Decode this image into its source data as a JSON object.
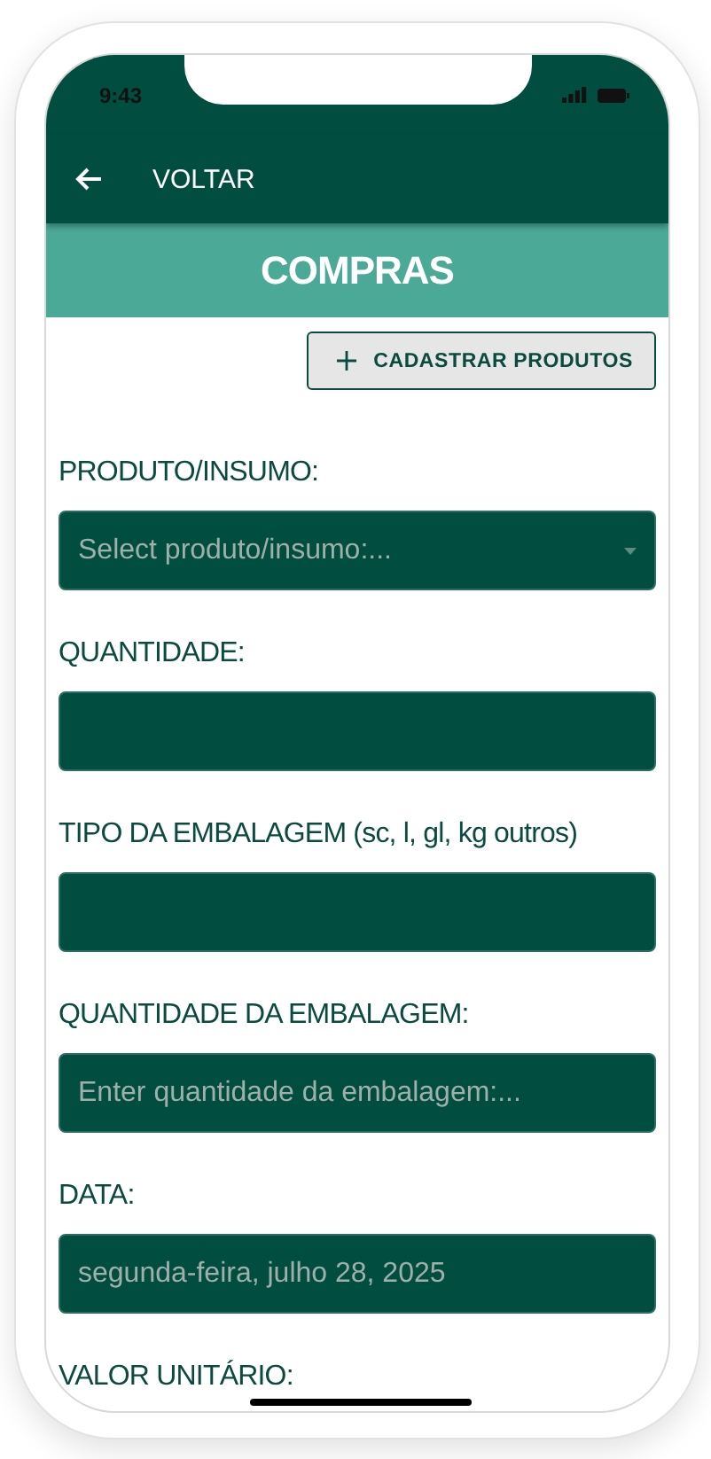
{
  "status_bar": {
    "time": "9:43"
  },
  "nav": {
    "back_label": "VOLTAR"
  },
  "title": "COMPRAS",
  "add_button": {
    "label": "CADASTRAR PRODUTOS"
  },
  "fields": [
    {
      "kind": "select",
      "label": "PRODUTO/INSUMO:",
      "placeholder": "Select produto/insumo:..."
    },
    {
      "kind": "input",
      "label": "QUANTIDADE:"
    },
    {
      "kind": "input",
      "label": "TIPO DA EMBALAGEM (sc, l, gl, kg outros)"
    },
    {
      "kind": "input",
      "label": "QUANTIDADE DA EMBALAGEM:",
      "placeholder": "Enter quantidade da embalagem:..."
    },
    {
      "kind": "date",
      "label": "DATA:",
      "value": "segunda-feira, julho 28, 2025"
    },
    {
      "kind": "label",
      "label": "VALOR UNITÁRIO:"
    }
  ]
}
